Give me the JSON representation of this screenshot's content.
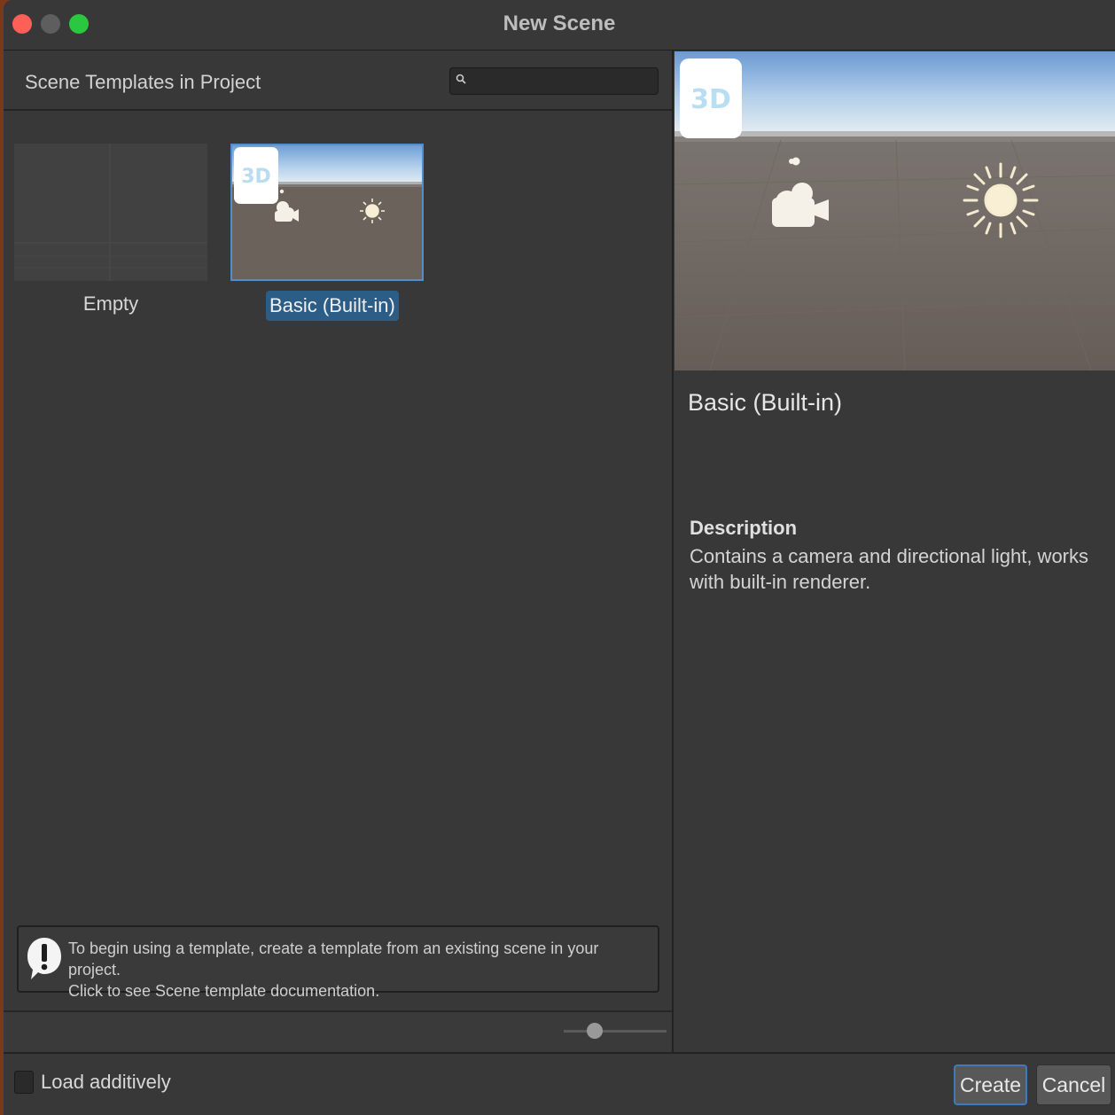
{
  "window": {
    "title": "New Scene"
  },
  "left": {
    "title": "Scene Templates in Project",
    "search": {
      "value": "",
      "placeholder": ""
    },
    "templates": [
      {
        "label": "Empty",
        "selected": false
      },
      {
        "label": "Basic (Built-in)",
        "selected": true,
        "badge": "3D"
      }
    ],
    "help": {
      "line1": "To begin using a template, create a template from an existing scene in your project.",
      "line2": "Click to see Scene template documentation."
    },
    "thumbnail_size_fraction": 0.3
  },
  "right": {
    "badge": "3D",
    "name": "Basic (Built-in)",
    "description_heading": "Description",
    "description": "Contains a camera and directional light, works with built-in renderer."
  },
  "footer": {
    "load_additively_label": "Load additively",
    "load_additively_checked": false,
    "create_label": "Create",
    "cancel_label": "Cancel"
  },
  "colors": {
    "selection": "#2c5d87",
    "accent_border": "#4f8ed0",
    "close": "#fe5f57",
    "maximize": "#29c840"
  }
}
